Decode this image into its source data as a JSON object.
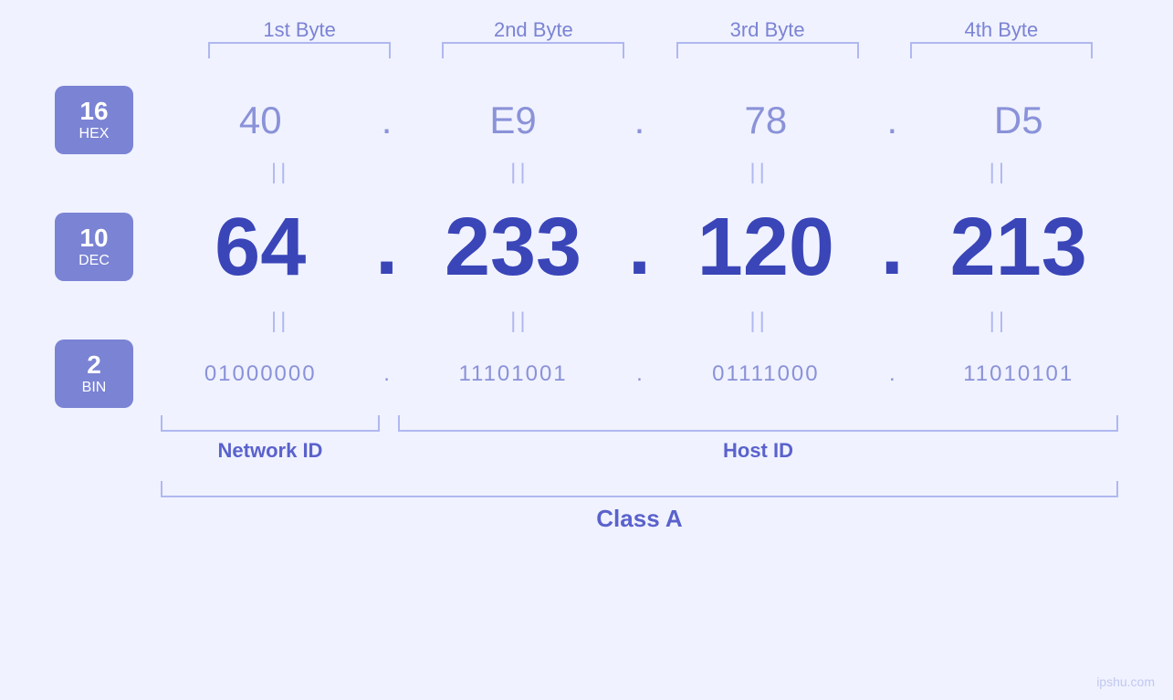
{
  "byteHeaders": [
    "1st Byte",
    "2nd Byte",
    "3rd Byte",
    "4th Byte"
  ],
  "bases": [
    {
      "number": "16",
      "label": "HEX"
    },
    {
      "number": "10",
      "label": "DEC"
    },
    {
      "number": "2",
      "label": "BIN"
    }
  ],
  "hexValues": [
    "40",
    "E9",
    "78",
    "D5"
  ],
  "decValues": [
    "64",
    "233",
    "120",
    "213"
  ],
  "binValues": [
    "01000000",
    "11101001",
    "01111000",
    "11010101"
  ],
  "dots": ".",
  "equalsSymbol": "||",
  "networkIdLabel": "Network ID",
  "hostIdLabel": "Host ID",
  "classLabel": "Class A",
  "watermark": "ipshu.com"
}
